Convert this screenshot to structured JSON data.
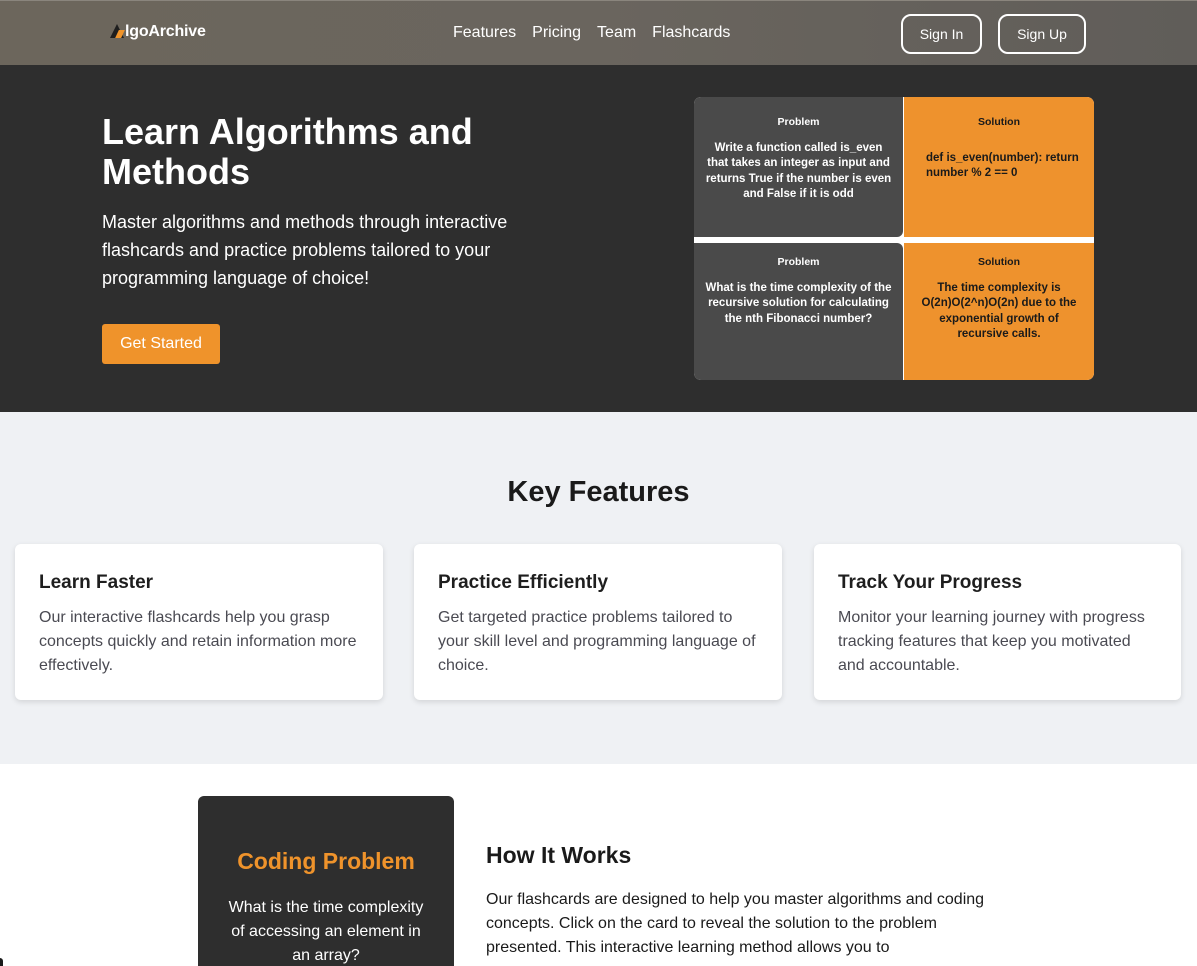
{
  "nav": {
    "logo": "lgoArchive",
    "links": [
      "Features",
      "Pricing",
      "Team",
      "Flashcards"
    ],
    "sign_in": "Sign In",
    "sign_up": "Sign Up"
  },
  "hero": {
    "title": "Learn Algorithms and Methods",
    "text": "Master algorithms and methods through interactive flashcards and practice problems tailored to your programming language of choice!",
    "cta": "Get Started",
    "cards": [
      {
        "heading": "Problem",
        "body": "Write a function called is_even that takes an integer as input and returns True if the number is even and False if it is odd"
      },
      {
        "heading": "Solution",
        "body": "def is_even(number): return number % 2 == 0"
      },
      {
        "heading": "Problem",
        "body": "What is the time complexity of the recursive solution for calculating the nth Fibonacci number?"
      },
      {
        "heading": "Solution",
        "body": "The time complexity is O(2n)O(2^n)O(2n) due to the exponential growth of recursive calls."
      }
    ]
  },
  "features": {
    "title": "Key Features",
    "items": [
      {
        "title": "Learn Faster",
        "text": "Our interactive flashcards help you grasp concepts quickly and retain information more effectively."
      },
      {
        "title": "Practice Efficiently",
        "text": "Get targeted practice problems tailored to your skill level and programming language of choice."
      },
      {
        "title": "Track Your Progress",
        "text": "Monitor your learning journey with progress tracking features that keep you motivated and accountable."
      }
    ]
  },
  "how": {
    "demo_title": "Coding Problem",
    "demo_text": "What is the time complexity of accessing an element in an array?",
    "title": "How It Works",
    "text": "Our flashcards are designed to help you master algorithms and coding concepts. Click on the card to reveal the solution to the problem presented. This interactive learning method allows you to"
  },
  "colors": {
    "accent": "#ef932b",
    "hero_bg": "#2e2e2e",
    "nav_bg": "#6a655e",
    "features_bg": "#eff1f4"
  }
}
